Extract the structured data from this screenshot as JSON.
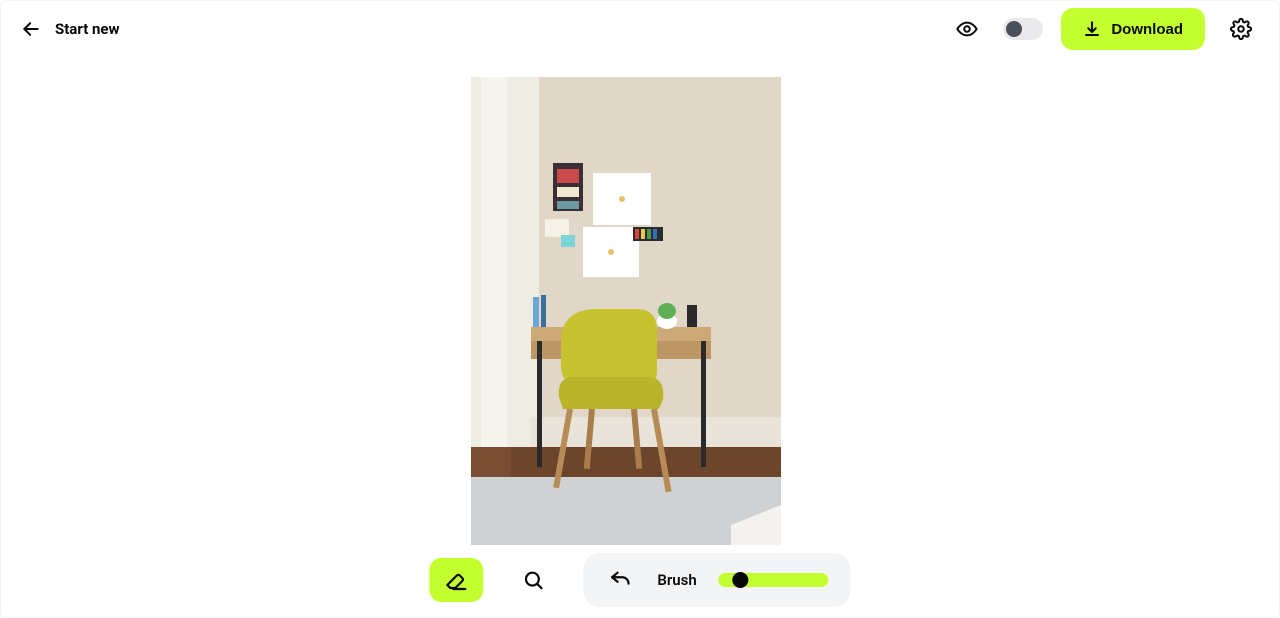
{
  "header": {
    "start_new_label": "Start new",
    "download_label": "Download"
  },
  "toolbar": {
    "brush_label": "Brush",
    "slider_percent": 20
  },
  "toggle_on": false,
  "accent_color": "#c4ff2f"
}
